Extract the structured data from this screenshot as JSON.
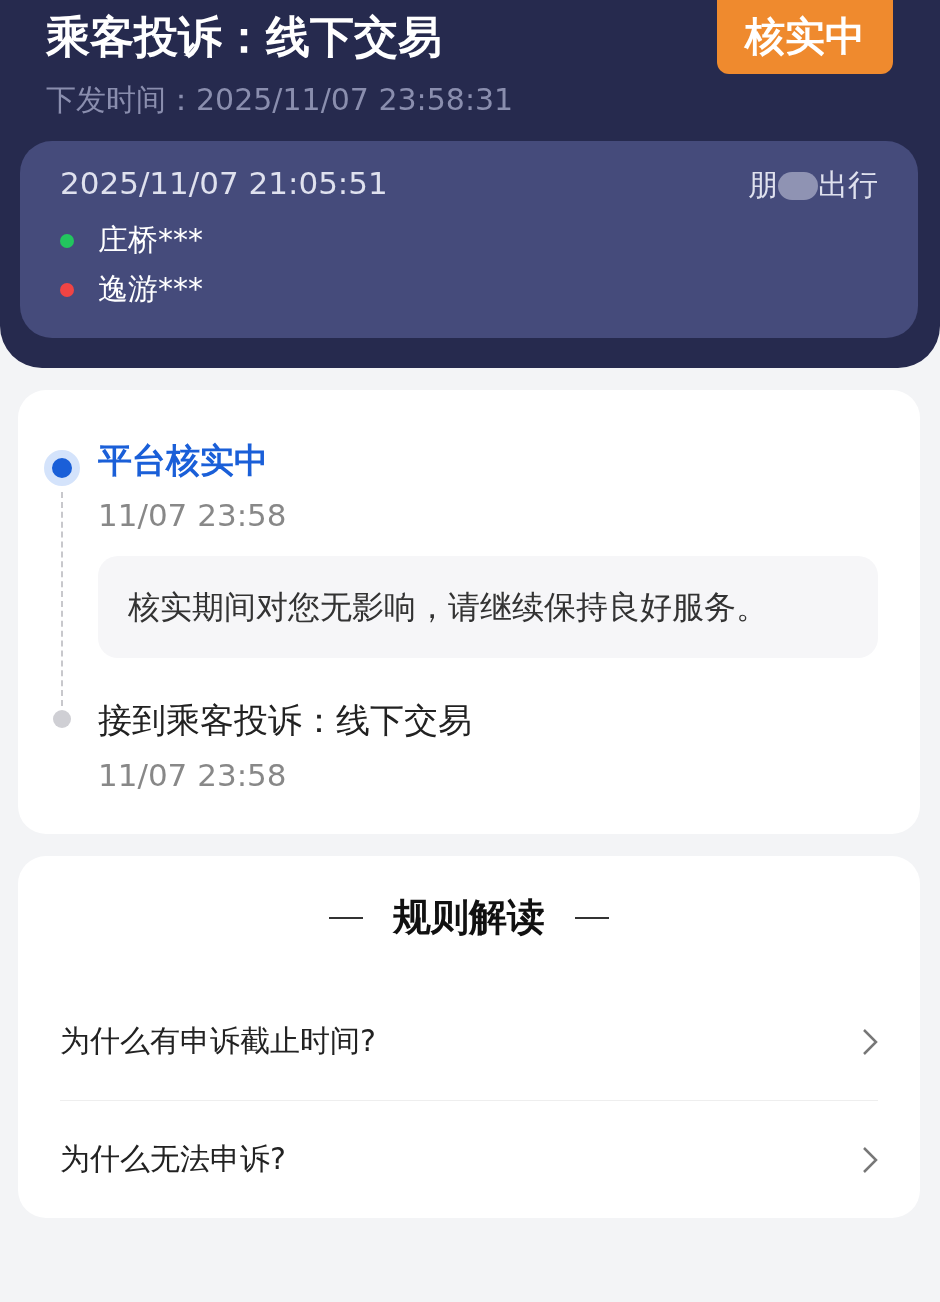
{
  "header": {
    "title": "乘客投诉：线下交易",
    "status_badge": "核实中",
    "issued_time": "下发时间：2025/11/07 23:58:31"
  },
  "trip": {
    "time": "2025/11/07 21:05:51",
    "brand_start": "朋",
    "brand_end": "出行",
    "stops": [
      {
        "name": "庄桥***",
        "color": "#22c55e"
      },
      {
        "name": "逸游***",
        "color": "#ef4444"
      }
    ]
  },
  "timeline": [
    {
      "title": "平台核实中",
      "time": "11/07 23:58",
      "note": "核实期间对您无影响，请继续保持良好服务。",
      "selected": true
    },
    {
      "title": "接到乘客投诉：线下交易",
      "time": "11/07 23:58",
      "selected": false
    }
  ],
  "rules": {
    "title": "规则解读",
    "items": [
      "为什么有申诉截止时间?",
      "为什么无法申诉?"
    ]
  }
}
